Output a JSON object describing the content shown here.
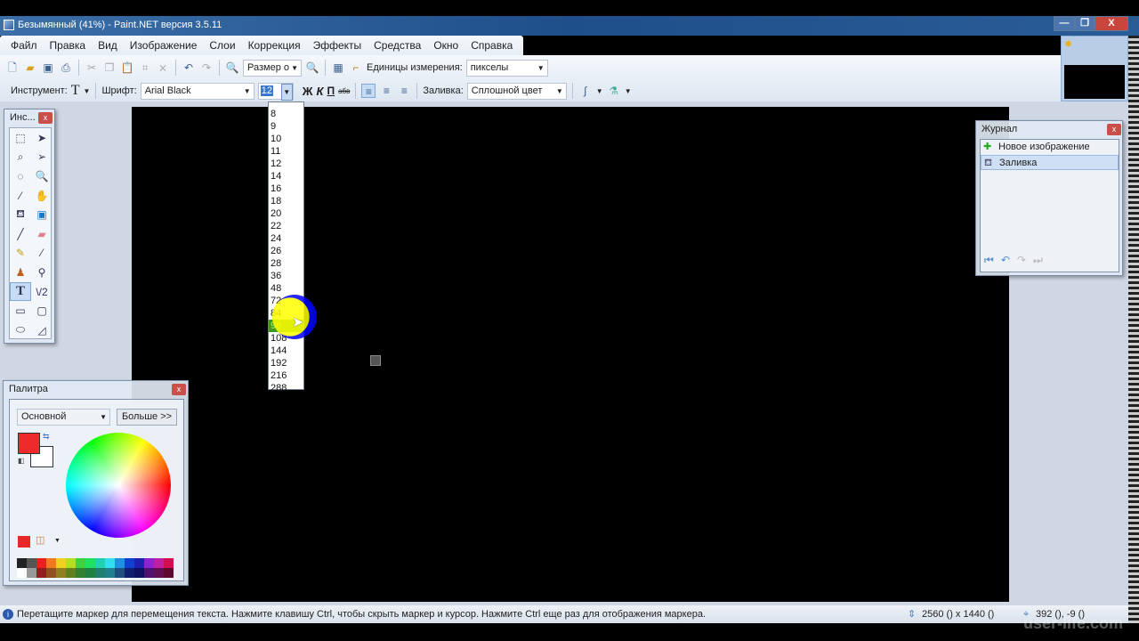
{
  "window": {
    "title": "Безымянный (41%) - Paint.NET версия 3.5.11",
    "minimize": "—",
    "restore": "❐",
    "close": "X"
  },
  "menu": [
    "Файл",
    "Правка",
    "Вид",
    "Изображение",
    "Слои",
    "Коррекция",
    "Эффекты",
    "Средства",
    "Окно",
    "Справка"
  ],
  "toolbar1": {
    "zoom_combo": "Размер о",
    "units_label": "Единицы измерения:",
    "units_value": "пикселы"
  },
  "toolbar2": {
    "tool_label": "Инструмент:",
    "tool_glyph": "T",
    "font_label": "Шрифт:",
    "font_value": "Arial Black",
    "size_value": "12",
    "bold": "Ж",
    "italic": "К",
    "underline": "П",
    "strike": "абв",
    "fill_label": "Заливка:",
    "fill_value": "Сплошной цвет"
  },
  "size_options": [
    "8",
    "9",
    "10",
    "11",
    "12",
    "14",
    "16",
    "18",
    "20",
    "22",
    "24",
    "26",
    "28",
    "36",
    "48",
    "72",
    "84",
    "96",
    "108",
    "144",
    "192",
    "216",
    "288"
  ],
  "size_highlighted": "96",
  "tools_window": {
    "title": "Инс...",
    "close": "x"
  },
  "palette": {
    "title": "Палитра",
    "close": "x",
    "mode": "Основной",
    "more_button": "Больше >>",
    "primary_color": "#ee2a2a",
    "secondary_color": "#ffffff",
    "swatches_top": [
      "#222222",
      "#555555",
      "#e82020",
      "#f07a20",
      "#f0d020",
      "#b0e020",
      "#40d040",
      "#20e060",
      "#20d0b0",
      "#30e0f0",
      "#2090e0",
      "#1040d0",
      "#2020b0",
      "#9020d0",
      "#c020a0",
      "#d01050"
    ],
    "swatches_bottom": [
      "#ffffff",
      "#999999",
      "#902020",
      "#905020",
      "#908020",
      "#608020",
      "#308030",
      "#208040",
      "#208070",
      "#208090",
      "#205080",
      "#102070",
      "#101060",
      "#501070",
      "#601050",
      "#600830"
    ]
  },
  "history": {
    "title": "Журнал",
    "close": "x",
    "items": [
      "Новое изображение",
      "Заливка"
    ]
  },
  "status": {
    "message": "Перетащите маркер для перемещения текста. Нажмите клавишу Ctrl, чтобы скрыть маркер и курсор. Нажмите Ctrl еще раз для отображения маркера.",
    "image_size": "2560 () x 1440 ()",
    "cursor_pos": "392 (), -9 ()"
  },
  "watermark": "user-life.com"
}
